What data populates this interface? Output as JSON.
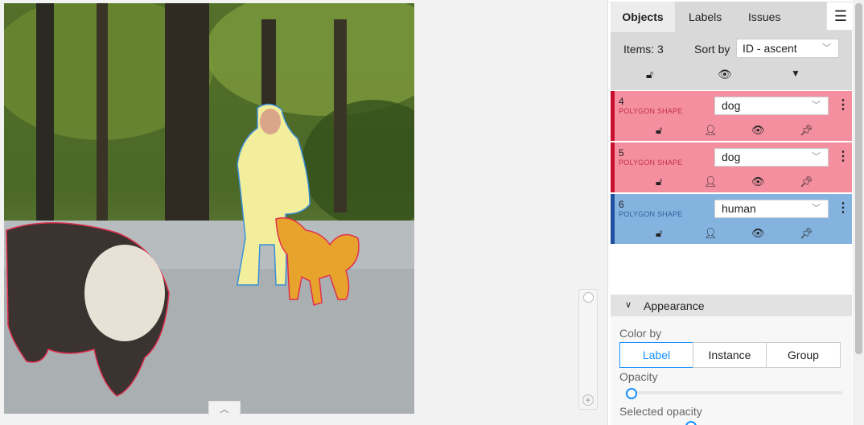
{
  "tabs": {
    "objects": "Objects",
    "labels": "Labels",
    "issues": "Issues"
  },
  "header": {
    "items_count": "Items: 3",
    "sort_label": "Sort by",
    "sort_value": "ID - ascent"
  },
  "objects": [
    {
      "id": "4",
      "type": "POLYGON SHAPE",
      "label": "dog",
      "color": "#f48fa0",
      "strip": "#c8102e"
    },
    {
      "id": "5",
      "type": "POLYGON SHAPE",
      "label": "dog",
      "color": "#f48fa0",
      "strip": "#c8102e"
    },
    {
      "id": "6",
      "type": "POLYGON SHAPE",
      "label": "human",
      "color": "#84b3e0",
      "strip": "#1f4fa0"
    }
  ],
  "appearance": {
    "title": "Appearance",
    "color_by": "Color by",
    "options": [
      "Label",
      "Instance",
      "Group"
    ],
    "selected_option": "Label",
    "opacity": "Opacity",
    "selected_opacity": "Selected opacity"
  },
  "icons": {
    "lock": "lock-icon",
    "user": "user-icon",
    "eye": "eye-icon",
    "pin": "pin-icon"
  },
  "colors": {
    "accent": "#1890ff",
    "dog": "#f48fa0",
    "human": "#84b3e0"
  }
}
